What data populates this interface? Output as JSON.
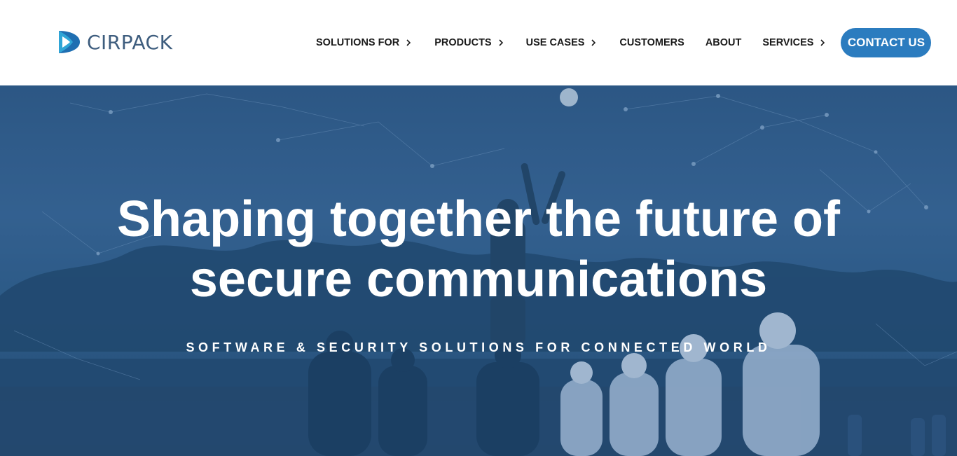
{
  "brand": {
    "name": "CIRPACK",
    "accent": "#2b7cbf",
    "text_color": "#3e5d7e"
  },
  "nav": {
    "items": [
      {
        "label": "SOLUTIONS FOR",
        "has_submenu": true
      },
      {
        "label": "PRODUCTS",
        "has_submenu": true
      },
      {
        "label": "USE CASES",
        "has_submenu": true
      },
      {
        "label": "CUSTOMERS",
        "has_submenu": false
      },
      {
        "label": "ABOUT",
        "has_submenu": false
      },
      {
        "label": "SERVICES",
        "has_submenu": true
      }
    ],
    "contact_label": "CONTACT US"
  },
  "hero": {
    "title_line1": "Shaping together the future of",
    "title_line2": "secure communications",
    "subtitle": "SOFTWARE & SECURITY SOLUTIONS FOR CONNECTED WORLD",
    "overlay_color": "#2e5a82"
  }
}
